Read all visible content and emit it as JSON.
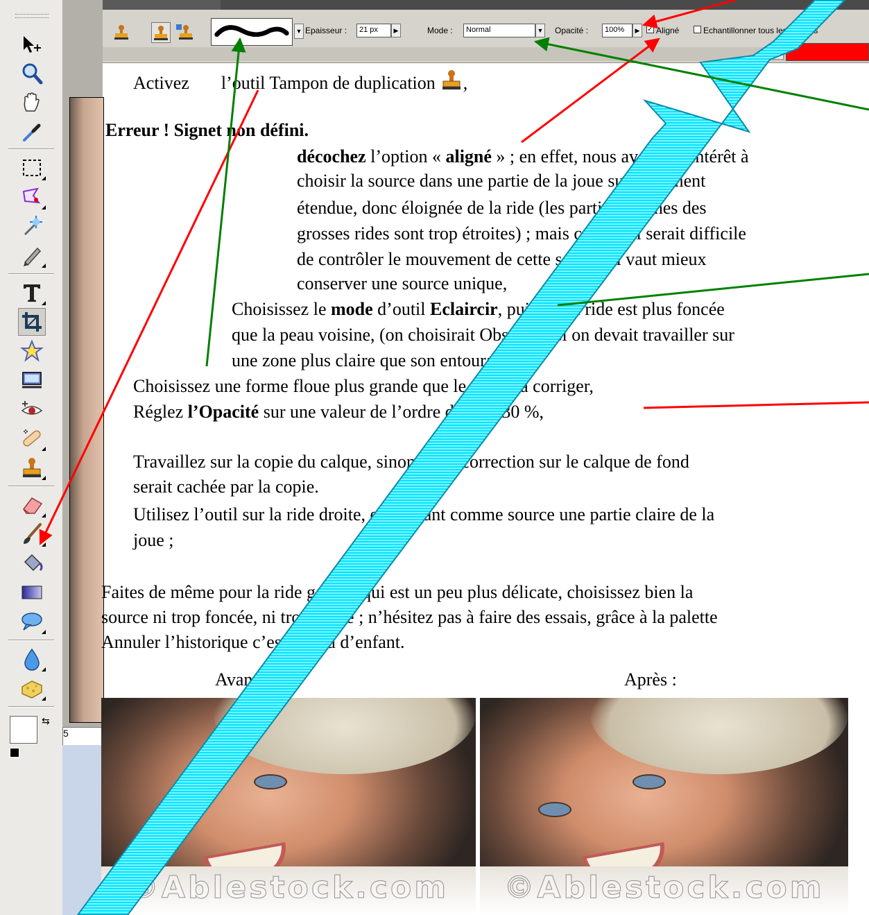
{
  "options_bar": {
    "size_label": "Epaisseur :",
    "size_value": "21 px",
    "mode_label": "Mode :",
    "mode_value": "Normal",
    "opacity_label": "Opacité :",
    "opacity_value": "100%",
    "aligned_label": "Aligné",
    "aligned_checked": true,
    "sample_all_label": "Echantillonner tous les calques",
    "sample_all_checked": false,
    "check_mark": "✓",
    "swatch_color": "#ff0000"
  },
  "toolbox": {
    "zoom_field": "5",
    "tools": [
      "move-tool",
      "zoom-tool",
      "hand-tool",
      "eyedropper-tool",
      "marquee-tool",
      "lasso-tool",
      "magic-wand-tool",
      "pencil-tool",
      "type-tool",
      "crop-tool",
      "custom-shape-tool",
      "cookie-cutter-tool",
      "red-eye-tool",
      "healing-brush-tool",
      "clone-stamp-tool",
      "eraser-tool",
      "brush-tool",
      "paint-bucket-tool",
      "gradient-tool",
      "speech-bubble-tool",
      "blur-tool",
      "sponge-tool"
    ]
  },
  "document": {
    "line1_a": "Activez",
    "line1_b": "l’outil Tampon de duplication",
    "line1_c": ",",
    "error_bookmark": "Erreur ! Signet non défini.",
    "aligned_para": {
      "bold1": "décochez",
      "t1": " l’option « ",
      "bold2": "aligné",
      "t2": " » ; en effet, nous avons ici intérêt à",
      "l2": "choisir la source dans une partie de la joue suffisamment",
      "l3": "étendue, donc éloignée de la ride (les parties proches des",
      "l4": "grosses rides sont trop étroites) ; mais comme il serait difficile",
      "l5": "de contrôler le mouvement de cette source, il vaut mieux",
      "l6": "conserver une source unique,"
    },
    "mode_para": {
      "t1": "Choisissez le ",
      "bold1": "mode",
      "t2": " d’outil ",
      "bold2": "Eclaircir",
      "t3": ", puisque la ride est plus foncée",
      "l2": "que la peau voisine, (on choisirait Obscurcir si on devait travailler sur",
      "l3": "une zone plus claire que son entourage),"
    },
    "shape_line": "Choisissez une forme floue plus grande que le défaut à corriger,",
    "opacity_line": {
      "t1": "Réglez ",
      "bold1": "l’Opacité",
      "t2": " sur une valeur de l’ordre de 20 à 30 %,"
    },
    "copy_para": {
      "l1": "Travaillez sur la copie du calque, sinon votre correction sur le calque de fond",
      "l2": "serait cachée par la copie."
    },
    "use_para": {
      "l1": "Utilisez l’outil sur la ride droite, en prenant comme source une partie claire de la",
      "l2": "joue ;"
    },
    "left_para": {
      "l1": "Faites de même pour la ride gauche qui est un peu plus délicate, choisissez bien la",
      "l2": "source ni trop foncée, ni trop claire ; n’hésitez pas à faire des essais, grâce à la palette",
      "l3": "Annuler l’historique c’est un jeu d’enfant."
    },
    "before_label": "Avant :",
    "after_label": "Après :",
    "watermark": "©Ablestock.com"
  },
  "annotation_colors": {
    "red": "#ff0000",
    "green": "#008000",
    "band": "#00e5ff"
  }
}
